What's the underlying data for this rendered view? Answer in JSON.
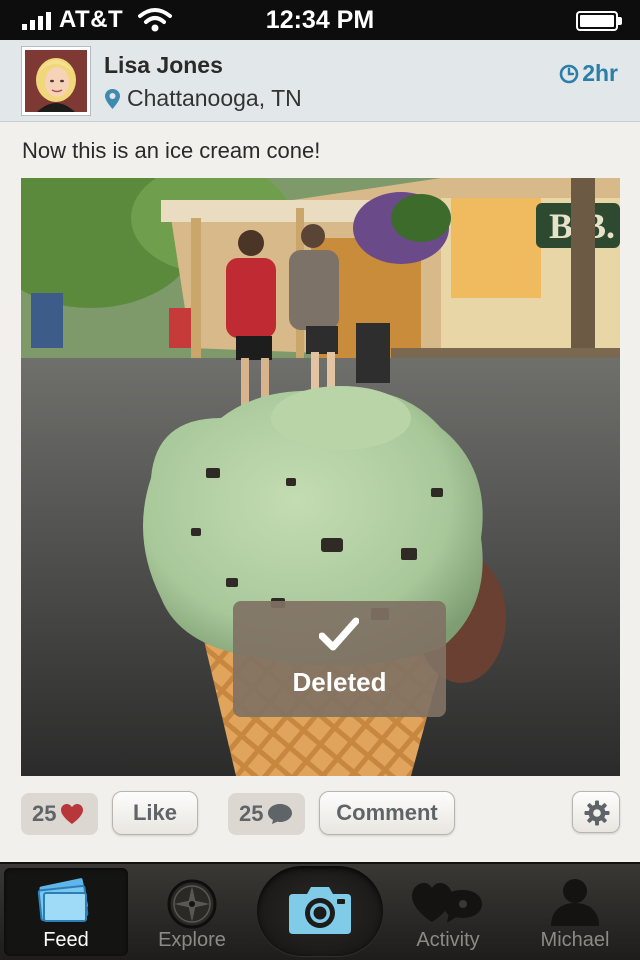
{
  "status_bar": {
    "carrier": "AT&T",
    "time": "12:34 PM",
    "signal_icon": "signal-bars-icon",
    "wifi_icon": "wifi-icon",
    "battery_icon": "battery-full-icon"
  },
  "post": {
    "author": "Lisa Jones",
    "location": "Chattanooga, TN",
    "time_ago": "2hr",
    "caption": "Now this is an ice cream cone!",
    "toast": "Deleted",
    "like_count": "25",
    "comment_count": "25"
  },
  "actions": {
    "like_label": "Like",
    "comment_label": "Comment"
  },
  "tabs": [
    {
      "label": "Feed",
      "icon": "feed-icon",
      "active": true
    },
    {
      "label": "Explore",
      "icon": "compass-icon",
      "active": false
    },
    {
      "label": "",
      "icon": "camera-icon",
      "active": false
    },
    {
      "label": "Activity",
      "icon": "activity-icon",
      "active": false
    },
    {
      "label": "Michael",
      "icon": "profile-icon",
      "active": false
    }
  ],
  "colors": {
    "accent_blue": "#2a7ea8",
    "heart_red": "#b8373a",
    "header_bg": "#e2e7ea",
    "page_bg": "#f2f0ec"
  }
}
